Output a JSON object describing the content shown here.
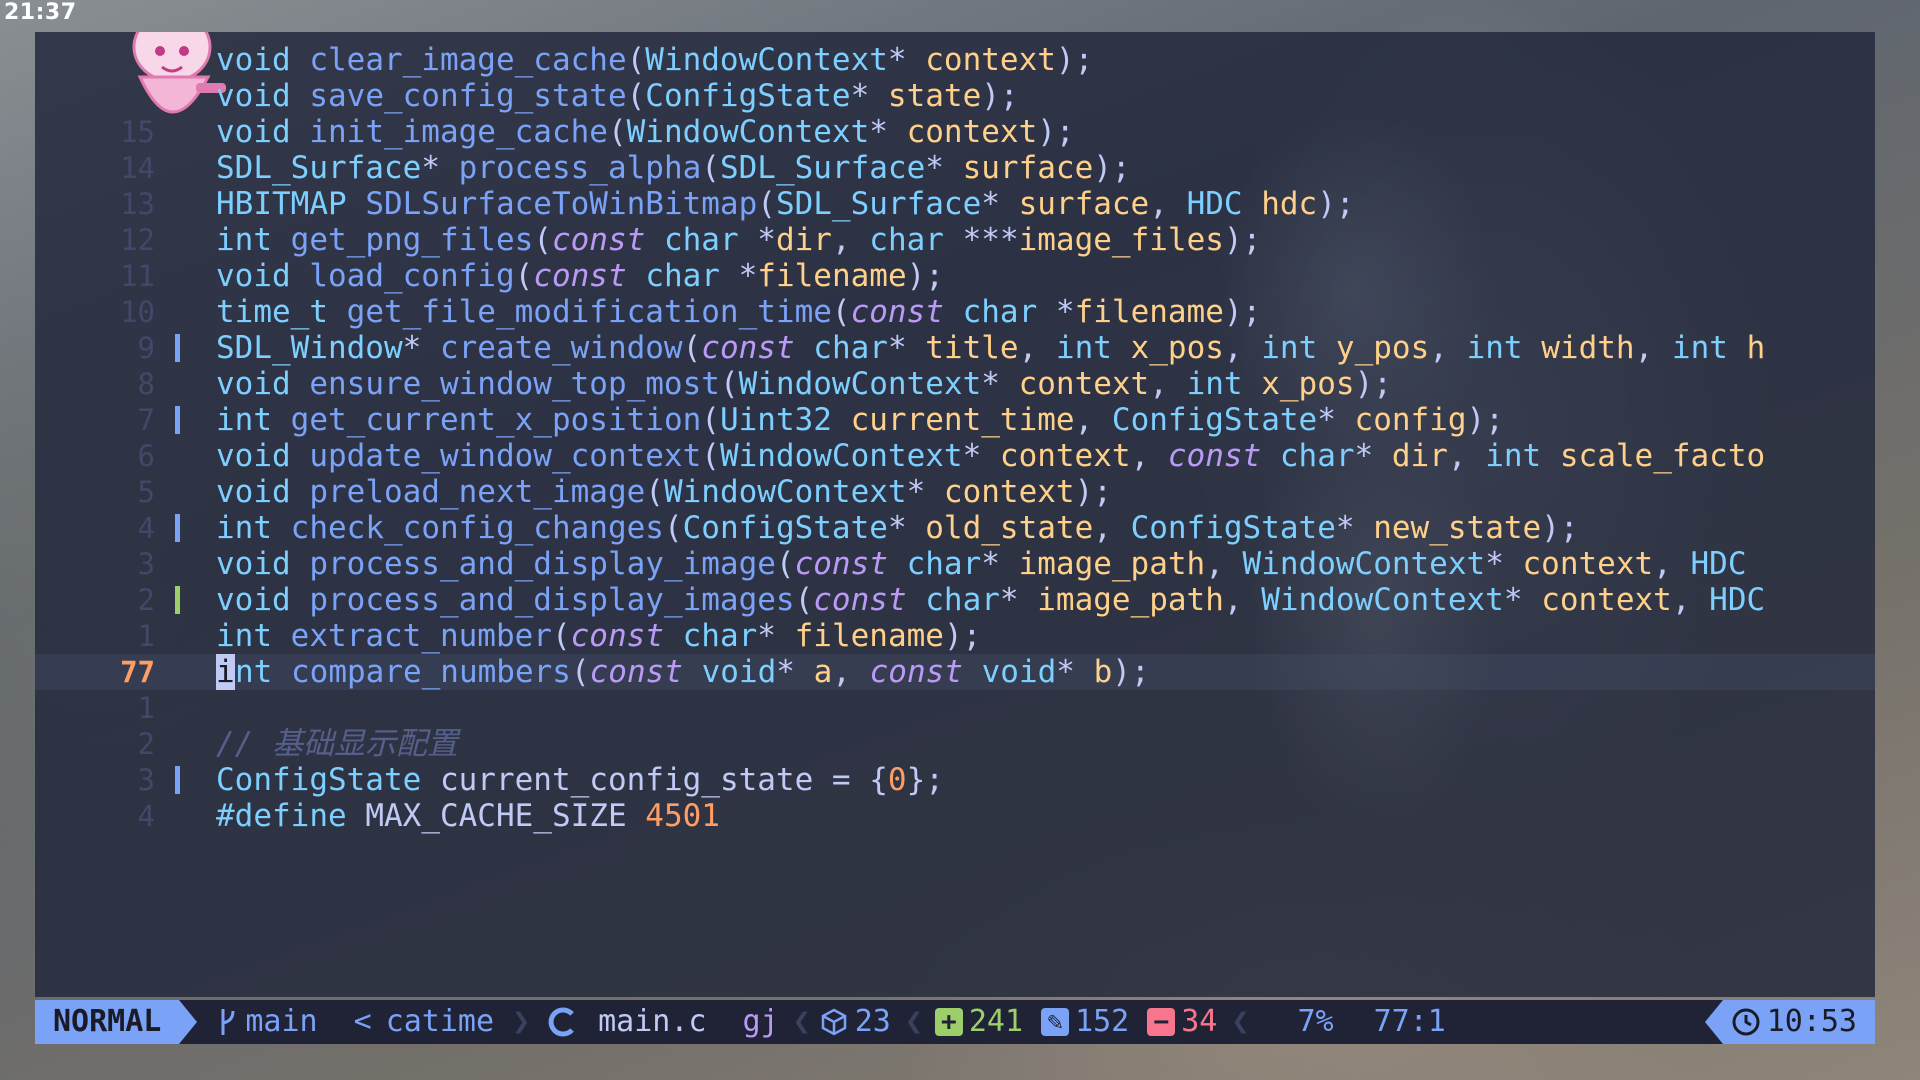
{
  "system": {
    "clock": "21:37"
  },
  "editor": {
    "lines": [
      {
        "num": "",
        "gutter": "",
        "tokens": [
          [
            "t",
            "void"
          ],
          [
            "p",
            " "
          ],
          [
            "f",
            "clear_image_cache"
          ],
          [
            "p",
            "("
          ],
          [
            "t",
            "WindowContext"
          ],
          [
            "p",
            "* "
          ],
          [
            "i",
            "context"
          ],
          [
            "p",
            ");"
          ]
        ]
      },
      {
        "num": "",
        "gutter": "",
        "tokens": [
          [
            "t",
            "void"
          ],
          [
            "p",
            " "
          ],
          [
            "f",
            "save_config_state"
          ],
          [
            "p",
            "("
          ],
          [
            "t",
            "ConfigState"
          ],
          [
            "p",
            "* "
          ],
          [
            "i",
            "state"
          ],
          [
            "p",
            ");"
          ]
        ]
      },
      {
        "num": "15",
        "gutter": "",
        "tokens": [
          [
            "t",
            "void"
          ],
          [
            "p",
            " "
          ],
          [
            "f",
            "init_image_cache"
          ],
          [
            "p",
            "("
          ],
          [
            "t",
            "WindowContext"
          ],
          [
            "p",
            "* "
          ],
          [
            "i",
            "context"
          ],
          [
            "p",
            ");"
          ]
        ]
      },
      {
        "num": "14",
        "gutter": "",
        "tokens": [
          [
            "t",
            "SDL_Surface"
          ],
          [
            "p",
            "* "
          ],
          [
            "f",
            "process_alpha"
          ],
          [
            "p",
            "("
          ],
          [
            "t",
            "SDL_Surface"
          ],
          [
            "p",
            "* "
          ],
          [
            "i",
            "surface"
          ],
          [
            "p",
            ");"
          ]
        ]
      },
      {
        "num": "13",
        "gutter": "",
        "tokens": [
          [
            "t",
            "HBITMAP"
          ],
          [
            "p",
            " "
          ],
          [
            "f",
            "SDLSurfaceToWinBitmap"
          ],
          [
            "p",
            "("
          ],
          [
            "t",
            "SDL_Surface"
          ],
          [
            "p",
            "* "
          ],
          [
            "i",
            "surface"
          ],
          [
            "p",
            ", "
          ],
          [
            "t",
            "HDC"
          ],
          [
            "p",
            " "
          ],
          [
            "i",
            "hdc"
          ],
          [
            "p",
            ");"
          ]
        ]
      },
      {
        "num": "12",
        "gutter": "",
        "tokens": [
          [
            "t",
            "int"
          ],
          [
            "p",
            " "
          ],
          [
            "f",
            "get_png_files"
          ],
          [
            "p",
            "("
          ],
          [
            "k",
            "const"
          ],
          [
            "p",
            " "
          ],
          [
            "t",
            "char"
          ],
          [
            "p",
            " *"
          ],
          [
            "i",
            "dir"
          ],
          [
            "p",
            ", "
          ],
          [
            "t",
            "char"
          ],
          [
            "p",
            " ***"
          ],
          [
            "i",
            "image_files"
          ],
          [
            "p",
            ");"
          ]
        ]
      },
      {
        "num": "11",
        "gutter": "",
        "tokens": [
          [
            "t",
            "void"
          ],
          [
            "p",
            " "
          ],
          [
            "f",
            "load_config"
          ],
          [
            "p",
            "("
          ],
          [
            "k",
            "const"
          ],
          [
            "p",
            " "
          ],
          [
            "t",
            "char"
          ],
          [
            "p",
            " *"
          ],
          [
            "i",
            "filename"
          ],
          [
            "p",
            ");"
          ]
        ]
      },
      {
        "num": "10",
        "gutter": "",
        "tokens": [
          [
            "t",
            "time_t"
          ],
          [
            "p",
            " "
          ],
          [
            "f",
            "get_file_modification_time"
          ],
          [
            "p",
            "("
          ],
          [
            "k",
            "const"
          ],
          [
            "p",
            " "
          ],
          [
            "t",
            "char"
          ],
          [
            "p",
            " *"
          ],
          [
            "i",
            "filename"
          ],
          [
            "p",
            ");"
          ]
        ]
      },
      {
        "num": "9",
        "gutter": "blue",
        "tokens": [
          [
            "t",
            "SDL_Window"
          ],
          [
            "p",
            "* "
          ],
          [
            "f",
            "create_window"
          ],
          [
            "p",
            "("
          ],
          [
            "k",
            "const"
          ],
          [
            "p",
            " "
          ],
          [
            "t",
            "char"
          ],
          [
            "p",
            "* "
          ],
          [
            "i",
            "title"
          ],
          [
            "p",
            ", "
          ],
          [
            "t",
            "int"
          ],
          [
            "p",
            " "
          ],
          [
            "i",
            "x_pos"
          ],
          [
            "p",
            ", "
          ],
          [
            "t",
            "int"
          ],
          [
            "p",
            " "
          ],
          [
            "i",
            "y_pos"
          ],
          [
            "p",
            ", "
          ],
          [
            "t",
            "int"
          ],
          [
            "p",
            " "
          ],
          [
            "i",
            "width"
          ],
          [
            "p",
            ", "
          ],
          [
            "t",
            "int"
          ],
          [
            "p",
            " "
          ],
          [
            "i",
            "h"
          ]
        ]
      },
      {
        "num": "8",
        "gutter": "",
        "tokens": [
          [
            "t",
            "void"
          ],
          [
            "p",
            " "
          ],
          [
            "f",
            "ensure_window_top_most"
          ],
          [
            "p",
            "("
          ],
          [
            "t",
            "WindowContext"
          ],
          [
            "p",
            "* "
          ],
          [
            "i",
            "context"
          ],
          [
            "p",
            ", "
          ],
          [
            "t",
            "int"
          ],
          [
            "p",
            " "
          ],
          [
            "i",
            "x_pos"
          ],
          [
            "p",
            ");"
          ]
        ]
      },
      {
        "num": "7",
        "gutter": "blue",
        "tokens": [
          [
            "t",
            "int"
          ],
          [
            "p",
            " "
          ],
          [
            "f",
            "get_current_x_position"
          ],
          [
            "p",
            "("
          ],
          [
            "t",
            "Uint32"
          ],
          [
            "p",
            " "
          ],
          [
            "i",
            "current_time"
          ],
          [
            "p",
            ", "
          ],
          [
            "t",
            "ConfigState"
          ],
          [
            "p",
            "* "
          ],
          [
            "i",
            "config"
          ],
          [
            "p",
            ");"
          ]
        ]
      },
      {
        "num": "6",
        "gutter": "",
        "tokens": [
          [
            "t",
            "void"
          ],
          [
            "p",
            " "
          ],
          [
            "f",
            "update_window_context"
          ],
          [
            "p",
            "("
          ],
          [
            "t",
            "WindowContext"
          ],
          [
            "p",
            "* "
          ],
          [
            "i",
            "context"
          ],
          [
            "p",
            ", "
          ],
          [
            "k",
            "const"
          ],
          [
            "p",
            " "
          ],
          [
            "t",
            "char"
          ],
          [
            "p",
            "* "
          ],
          [
            "i",
            "dir"
          ],
          [
            "p",
            ", "
          ],
          [
            "t",
            "int"
          ],
          [
            "p",
            " "
          ],
          [
            "i",
            "scale_facto"
          ]
        ]
      },
      {
        "num": "5",
        "gutter": "",
        "tokens": [
          [
            "t",
            "void"
          ],
          [
            "p",
            " "
          ],
          [
            "f",
            "preload_next_image"
          ],
          [
            "p",
            "("
          ],
          [
            "t",
            "WindowContext"
          ],
          [
            "p",
            "* "
          ],
          [
            "i",
            "context"
          ],
          [
            "p",
            ");"
          ]
        ]
      },
      {
        "num": "4",
        "gutter": "blue",
        "tokens": [
          [
            "t",
            "int"
          ],
          [
            "p",
            " "
          ],
          [
            "f",
            "check_config_changes"
          ],
          [
            "p",
            "("
          ],
          [
            "t",
            "ConfigState"
          ],
          [
            "p",
            "* "
          ],
          [
            "i",
            "old_state"
          ],
          [
            "p",
            ", "
          ],
          [
            "t",
            "ConfigState"
          ],
          [
            "p",
            "* "
          ],
          [
            "i",
            "new_state"
          ],
          [
            "p",
            ");"
          ]
        ]
      },
      {
        "num": "3",
        "gutter": "",
        "tokens": [
          [
            "t",
            "void"
          ],
          [
            "p",
            " "
          ],
          [
            "f",
            "process_and_display_image"
          ],
          [
            "p",
            "("
          ],
          [
            "k",
            "const"
          ],
          [
            "p",
            " "
          ],
          [
            "t",
            "char"
          ],
          [
            "p",
            "* "
          ],
          [
            "i",
            "image_path"
          ],
          [
            "p",
            ", "
          ],
          [
            "t",
            "WindowContext"
          ],
          [
            "p",
            "* "
          ],
          [
            "i",
            "context"
          ],
          [
            "p",
            ", "
          ],
          [
            "t",
            "HDC"
          ]
        ]
      },
      {
        "num": "2",
        "gutter": "green",
        "tokens": [
          [
            "t",
            "void"
          ],
          [
            "p",
            " "
          ],
          [
            "f",
            "process_and_display_images"
          ],
          [
            "p",
            "("
          ],
          [
            "k",
            "const"
          ],
          [
            "p",
            " "
          ],
          [
            "t",
            "char"
          ],
          [
            "p",
            "* "
          ],
          [
            "i",
            "image_path"
          ],
          [
            "p",
            ", "
          ],
          [
            "t",
            "WindowContext"
          ],
          [
            "p",
            "* "
          ],
          [
            "i",
            "context"
          ],
          [
            "p",
            ", "
          ],
          [
            "t",
            "HDC"
          ]
        ]
      },
      {
        "num": "1",
        "gutter": "",
        "tokens": [
          [
            "t",
            "int"
          ],
          [
            "p",
            " "
          ],
          [
            "f",
            "extract_number"
          ],
          [
            "p",
            "("
          ],
          [
            "k",
            "const"
          ],
          [
            "p",
            " "
          ],
          [
            "t",
            "char"
          ],
          [
            "p",
            "* "
          ],
          [
            "i",
            "filename"
          ],
          [
            "p",
            ");"
          ]
        ]
      },
      {
        "num": "77",
        "gutter": "",
        "current": true,
        "tokens": [
          [
            "cur",
            "i"
          ],
          [
            "t",
            "nt"
          ],
          [
            "p",
            " "
          ],
          [
            "f",
            "compare_numbers"
          ],
          [
            "p",
            "("
          ],
          [
            "k",
            "const"
          ],
          [
            "p",
            " "
          ],
          [
            "t",
            "void"
          ],
          [
            "p",
            "* "
          ],
          [
            "i",
            "a"
          ],
          [
            "p",
            ", "
          ],
          [
            "k",
            "const"
          ],
          [
            "p",
            " "
          ],
          [
            "t",
            "void"
          ],
          [
            "p",
            "* "
          ],
          [
            "i",
            "b"
          ],
          [
            "p",
            ");"
          ]
        ]
      },
      {
        "num": "1",
        "gutter": "",
        "tokens": []
      },
      {
        "num": "2",
        "gutter": "",
        "tokens": [
          [
            "c",
            "// 基础显示配置"
          ]
        ]
      },
      {
        "num": "3",
        "gutter": "blue",
        "tokens": [
          [
            "t",
            "ConfigState"
          ],
          [
            "p",
            " "
          ],
          [
            "x",
            "current_config_state"
          ],
          [
            "p",
            " = {"
          ],
          [
            "n",
            "0"
          ],
          [
            "p",
            "};"
          ]
        ]
      },
      {
        "num": "4",
        "gutter": "",
        "tokens": [
          [
            "pp",
            "#define"
          ],
          [
            "p",
            " "
          ],
          [
            "x",
            "MAX_CACHE_SIZE"
          ],
          [
            "p",
            " "
          ],
          [
            "n",
            "4501"
          ]
        ]
      }
    ]
  },
  "statusline": {
    "mode": "NORMAL",
    "branch_icon": "git-branch-icon",
    "branch": "main",
    "project_prefix": "<",
    "project": "catime",
    "filetype_icon": "c-language-icon",
    "filename": "main.c",
    "keys": "gj",
    "lsp_icon": "cube-icon",
    "lsp_count": "23",
    "added_icon": "plus-square-icon",
    "added": "241",
    "changed_icon": "pencil-icon",
    "changed": "152",
    "removed_icon": "minus-square-icon",
    "removed": "34",
    "progress": "7%",
    "position": "77:1",
    "clock_icon": "clock-icon",
    "time": "10:53"
  },
  "colors": {
    "accent": "#7aa2f7",
    "type": "#7dcfff",
    "keyword": "#bb9af7",
    "identifier": "#ffd08a",
    "added": "#9ece6a",
    "removed": "#f7768e",
    "active_line_number": "#ff9e64"
  }
}
